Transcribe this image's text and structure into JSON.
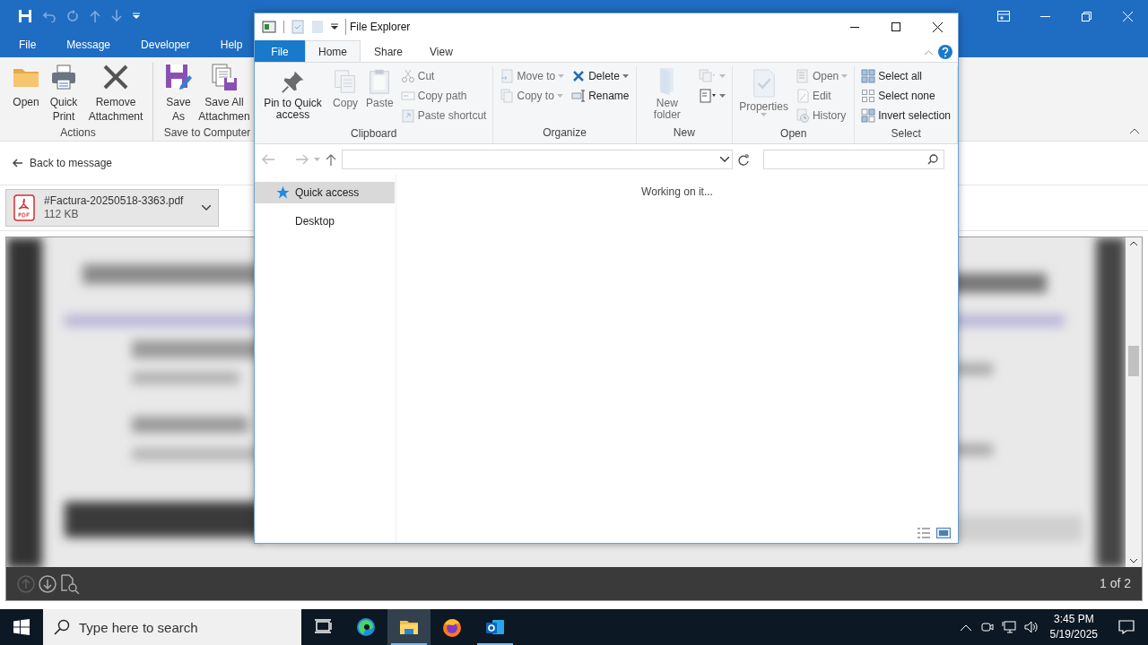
{
  "outlook": {
    "menu_tabs": [
      {
        "label": "File"
      },
      {
        "label": "Message"
      },
      {
        "label": "Developer"
      },
      {
        "label": "Help"
      }
    ],
    "ribbon_groups": [
      {
        "label": "Actions",
        "buttons": [
          {
            "label": "Open"
          },
          {
            "label": "Quick Print"
          },
          {
            "label": "Remove Attachment"
          }
        ]
      },
      {
        "label": "Save to Computer",
        "buttons": [
          {
            "label": "Save As"
          },
          {
            "label": "Save All Attachmen"
          }
        ]
      }
    ],
    "back_link": "Back to message",
    "attachment": {
      "name": "#Factura-20250518-3363.pdf",
      "size": "112 KB"
    },
    "preview": {
      "kind": "picture",
      "page_indicator": "1 of 2"
    }
  },
  "explorer": {
    "title": "File Explorer",
    "tabs": [
      {
        "label": "File",
        "kind": "file",
        "selected": false
      },
      {
        "label": "Home",
        "kind": "tab",
        "selected": true
      },
      {
        "label": "Share",
        "kind": "tab",
        "selected": false
      },
      {
        "label": "View",
        "kind": "tab",
        "selected": false
      }
    ],
    "ribbon_groups": [
      {
        "label": "Clipboard",
        "items": [
          {
            "kind": "large",
            "label": "Pin to Quick access",
            "disabled": false
          },
          {
            "kind": "large",
            "label": "Copy",
            "disabled": true
          },
          {
            "kind": "large",
            "label": "Paste",
            "disabled": true
          },
          {
            "kind": "stack",
            "buttons": [
              {
                "label": "Cut",
                "disabled": true
              },
              {
                "label": "Copy path",
                "disabled": true
              },
              {
                "label": "Paste shortcut",
                "disabled": true
              }
            ]
          }
        ]
      },
      {
        "label": "Organize",
        "items": [
          {
            "kind": "stack",
            "buttons": [
              {
                "label": "Move to",
                "dropdown": true,
                "disabled": true
              },
              {
                "label": "Copy to",
                "dropdown": true,
                "disabled": true
              }
            ]
          },
          {
            "kind": "stack",
            "buttons": [
              {
                "label": "Delete",
                "dropdown": true,
                "disabled": false
              },
              {
                "label": "Rename",
                "disabled": false
              }
            ]
          }
        ]
      },
      {
        "label": "New",
        "items": [
          {
            "kind": "large",
            "label": "New folder",
            "disabled": true
          },
          {
            "kind": "stack",
            "buttons": [
              {
                "dropdown": true,
                "disabled": true
              },
              {
                "dropdown": true,
                "disabled": false
              }
            ]
          }
        ]
      },
      {
        "label": "Open",
        "items": [
          {
            "kind": "large",
            "label": "Properties",
            "dropdown": true,
            "disabled": true
          },
          {
            "kind": "stack",
            "buttons": [
              {
                "label": "Open",
                "dropdown": true,
                "disabled": true
              },
              {
                "label": "Edit",
                "disabled": true
              },
              {
                "label": "History",
                "disabled": true
              }
            ]
          }
        ]
      },
      {
        "label": "Select",
        "items": [
          {
            "kind": "stack",
            "buttons": [
              {
                "label": "Select all",
                "disabled": false
              },
              {
                "label": "Select none",
                "disabled": false
              },
              {
                "label": "Invert selection",
                "disabled": false
              }
            ]
          }
        ]
      }
    ],
    "nav_items": [
      {
        "label": "Quick access",
        "selected": true
      },
      {
        "label": "Desktop",
        "selected": false
      }
    ],
    "status": "Working on it..."
  },
  "taskbar": {
    "search_placeholder": "Type here to search",
    "apps": [
      {
        "active": false,
        "running": false
      },
      {
        "active": false,
        "running": false
      },
      {
        "active": true,
        "running": true
      },
      {
        "active": false,
        "running": false
      },
      {
        "active": false,
        "running": true
      }
    ],
    "clock": {
      "time": "3:45 PM",
      "date": "5/19/2025"
    }
  }
}
